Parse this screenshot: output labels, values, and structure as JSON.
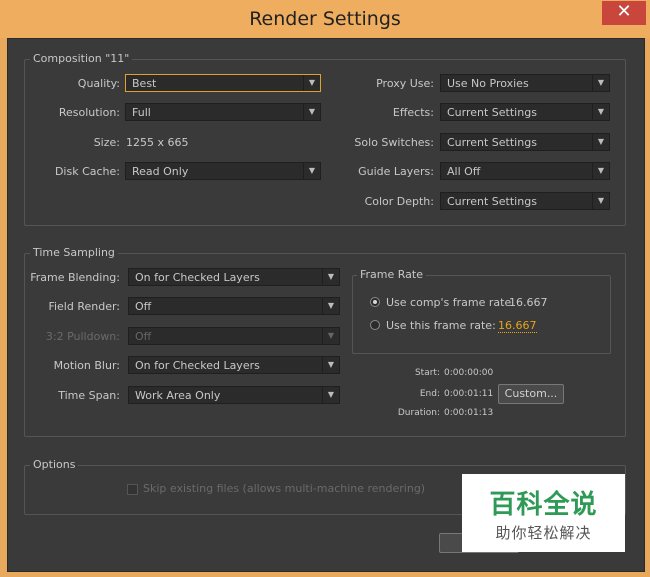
{
  "window": {
    "title": "Render Settings",
    "close_symbol": "✕"
  },
  "composition": {
    "group_label": "Composition \"11\"",
    "quality": {
      "label": "Quality:",
      "value": "Best"
    },
    "resolution": {
      "label": "Resolution:",
      "value": "Full"
    },
    "size": {
      "label": "Size:",
      "value": "1255 x 665"
    },
    "disk_cache": {
      "label": "Disk Cache:",
      "value": "Read Only"
    },
    "proxy_use": {
      "label": "Proxy Use:",
      "value": "Use No Proxies"
    },
    "effects": {
      "label": "Effects:",
      "value": "Current Settings"
    },
    "solo_switches": {
      "label": "Solo Switches:",
      "value": "Current Settings"
    },
    "guide_layers": {
      "label": "Guide Layers:",
      "value": "All Off"
    },
    "color_depth": {
      "label": "Color Depth:",
      "value": "Current Settings"
    }
  },
  "time_sampling": {
    "group_label": "Time Sampling",
    "frame_blending": {
      "label": "Frame Blending:",
      "value": "On for Checked Layers"
    },
    "field_render": {
      "label": "Field Render:",
      "value": "Off"
    },
    "pulldown": {
      "label": "3:2 Pulldown:",
      "value": "Off"
    },
    "motion_blur": {
      "label": "Motion Blur:",
      "value": "On for Checked Layers"
    },
    "time_span": {
      "label": "Time Span:",
      "value": "Work Area Only"
    },
    "frame_rate": {
      "group_label": "Frame Rate",
      "use_comp": {
        "label": "Use comp's frame rate",
        "value": "16.667",
        "selected": true
      },
      "use_this": {
        "label": "Use this frame rate:",
        "value": "16.667",
        "selected": false
      }
    },
    "start": {
      "label": "Start:",
      "value": "0:00:00:00"
    },
    "end": {
      "label": "End:",
      "value": "0:00:01:11"
    },
    "duration": {
      "label": "Duration:",
      "value": "0:00:01:13"
    },
    "custom_button": "Custom..."
  },
  "options": {
    "group_label": "Options",
    "skip_existing": {
      "label": "Skip existing files (allows multi-machine rendering)",
      "checked": false
    }
  },
  "watermark": {
    "big": "百科全说",
    "small": "助你轻松解决"
  },
  "dropdown_arrow": "▼",
  "colors": {
    "titlebar": "#efae5f",
    "panel": "#3a3a3a",
    "accent": "#e7a51b",
    "close": "#c9463d"
  }
}
